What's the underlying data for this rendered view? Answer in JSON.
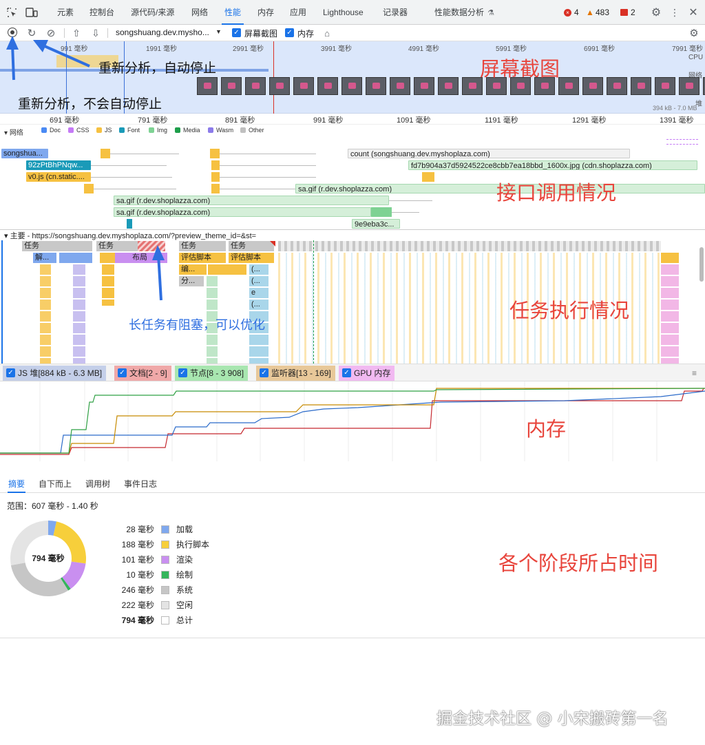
{
  "devtools_tabs": [
    "元素",
    "控制台",
    "源代码/来源",
    "网络",
    "性能",
    "内存",
    "应用",
    "Lighthouse",
    "记录器",
    "性能数据分析"
  ],
  "active_tab": "性能",
  "status_counts": {
    "errors": "4",
    "warnings": "483",
    "issues": "2"
  },
  "toolbar": {
    "url": "songshuang.dev.mysho...",
    "screenshots_label": "屏幕截图",
    "memory_label": "内存"
  },
  "overview": {
    "ticks": [
      "991 毫秒",
      "1991 毫秒",
      "2991 毫秒",
      "3991 毫秒",
      "4991 毫秒",
      "5991 毫秒",
      "6991 毫秒",
      "7991 毫秒"
    ],
    "cpu_label": "CPU",
    "net_label": "网络",
    "heap_label": "堆",
    "heap_range": "394 kB - 7.0 MB"
  },
  "ruler_ticks": [
    "691 毫秒",
    "791 毫秒",
    "891 毫秒",
    "991 毫秒",
    "1091 毫秒",
    "1191 毫秒",
    "1291 毫秒",
    "1391 毫秒"
  ],
  "network": {
    "label": "网络",
    "legend": [
      {
        "name": "Doc",
        "color": "#4a8af4"
      },
      {
        "name": "CSS",
        "color": "#c57af6"
      },
      {
        "name": "JS",
        "color": "#f6c141"
      },
      {
        "name": "Font",
        "color": "#1a9ab8"
      },
      {
        "name": "Img",
        "color": "#7ed293"
      },
      {
        "name": "Media",
        "color": "#1e9e4b"
      },
      {
        "name": "Wasm",
        "color": "#8c7bea"
      },
      {
        "name": "Other",
        "color": "#c0c0c0"
      }
    ],
    "requests": [
      "songshua...",
      "92zPtBhPNqw...",
      "v0.js (cn.static....",
      "count (songshuang.dev.myshoplaza.com)",
      "fd7b904a37d5924522ce8cbb7ea18bbd_1600x.jpg (cdn.shoplazza.com)",
      "sa.gif (r.dev.shoplazza.com)",
      "sa.gif (r.dev.shoplazza.com)",
      "sa.gif (r.dev.shoplazza.com)",
      "9e9eba3c..."
    ]
  },
  "main_thread": {
    "header": "主要 - https://songshuang.dev.myshoplaza.com/?preview_theme_id=&st=",
    "tasks": [
      "任务",
      "任务",
      "任务",
      "任务"
    ],
    "sub": [
      "解...",
      "布局",
      "评估脚本",
      "评估脚本",
      "编...",
      "分...",
      "(...",
      "(...",
      "(...",
      "e",
      "(...",
      "(..."
    ]
  },
  "memory_counters": [
    "JS 堆[884 kB - 6.3 MB]",
    "文档[2 - 9]",
    "节点[8 - 3 908]",
    "监听器[13 - 169]",
    "GPU 内存"
  ],
  "bottom_tabs": [
    "摘要",
    "自下而上",
    "调用树",
    "事件日志"
  ],
  "summary": {
    "range": "范围：607 毫秒 - 1.40 秒",
    "total_center": "794 毫秒",
    "rows": [
      {
        "value": "28 毫秒",
        "label": "加载",
        "color": "#7fa8ee",
        "bold": false
      },
      {
        "value": "188 毫秒",
        "label": "执行脚本",
        "color": "#f7cf3b",
        "bold": false
      },
      {
        "value": "101 毫秒",
        "label": "渲染",
        "color": "#c98ff0",
        "bold": false
      },
      {
        "value": "10 毫秒",
        "label": "绘制",
        "color": "#35b55b",
        "bold": false
      },
      {
        "value": "246 毫秒",
        "label": "系统",
        "color": "#c6c6c6",
        "bold": false
      },
      {
        "value": "222 毫秒",
        "label": "空闲",
        "color": "#e4e4e4",
        "bold": false
      },
      {
        "value": "794 毫秒",
        "label": "总计",
        "color": "#ffffff",
        "bold": true
      }
    ],
    "donut": [
      28,
      188,
      101,
      10,
      246,
      222
    ]
  },
  "annotations": {
    "screenshot": "屏幕截图",
    "network": "接口调用情况",
    "tasks": "任务执行情况",
    "memory": "内存",
    "phases": "各个阶段所占时间",
    "reload_auto": "重新分析，自动停止",
    "reload_manual": "重新分析，不会自动停止",
    "long_task": "长任务有阻塞，可以优化",
    "watermark": "掘金技术社区 @ 小宋搬砖第一名"
  }
}
